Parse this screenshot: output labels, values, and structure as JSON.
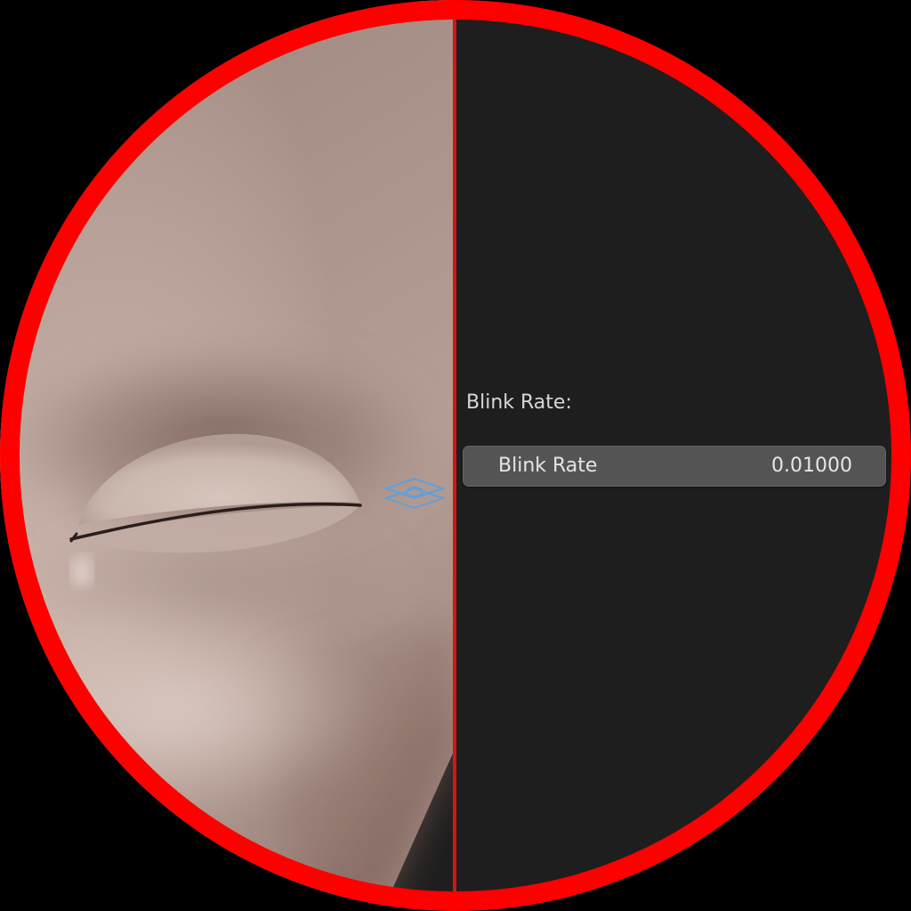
{
  "viewport": {
    "object": "eye-mesh"
  },
  "properties": {
    "section_label": "Blink Rate:",
    "blink_rate": {
      "name": "Blink Rate",
      "value": "0.01000"
    }
  },
  "colors": {
    "skin": "#c4aea5",
    "panel_background": "#1e1e1e",
    "field_background": "#545454",
    "divider": "#d51515",
    "ring": "#ff0000",
    "gizmo": "#5aa0e0"
  }
}
